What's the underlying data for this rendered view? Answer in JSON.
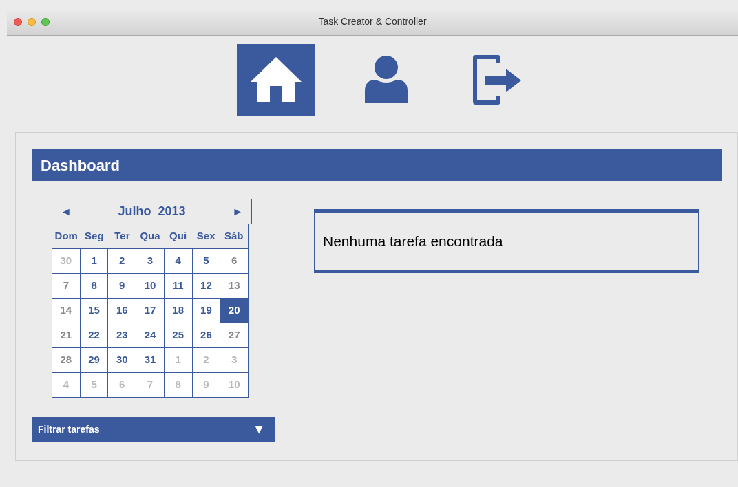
{
  "window": {
    "title": "Task Creator & Controller"
  },
  "nav": [
    {
      "kind": "home",
      "selected": true
    },
    {
      "kind": "user",
      "selected": false
    },
    {
      "kind": "logout",
      "selected": false
    }
  ],
  "dashboard": {
    "title": "Dashboard"
  },
  "calendar": {
    "prev": "◄",
    "month": "Julho",
    "year": "2013",
    "next": "►",
    "weekdays": [
      "Dom",
      "Seg",
      "Ter",
      "Qua",
      "Qui",
      "Sex",
      "Sáb"
    ],
    "weeks": [
      [
        {
          "day": "30",
          "kind": "other",
          "selected": false
        },
        {
          "day": "1",
          "kind": "current",
          "selected": false
        },
        {
          "day": "2",
          "kind": "current",
          "selected": false
        },
        {
          "day": "3",
          "kind": "current",
          "selected": false
        },
        {
          "day": "4",
          "kind": "current",
          "selected": false
        },
        {
          "day": "5",
          "kind": "current",
          "selected": false
        },
        {
          "day": "6",
          "kind": "weekend",
          "selected": false
        }
      ],
      [
        {
          "day": "7",
          "kind": "weekend",
          "selected": false
        },
        {
          "day": "8",
          "kind": "current",
          "selected": false
        },
        {
          "day": "9",
          "kind": "current",
          "selected": false
        },
        {
          "day": "10",
          "kind": "current",
          "selected": false
        },
        {
          "day": "11",
          "kind": "current",
          "selected": false
        },
        {
          "day": "12",
          "kind": "current",
          "selected": false
        },
        {
          "day": "13",
          "kind": "weekend",
          "selected": false
        }
      ],
      [
        {
          "day": "14",
          "kind": "weekend",
          "selected": false
        },
        {
          "day": "15",
          "kind": "current",
          "selected": false
        },
        {
          "day": "16",
          "kind": "current",
          "selected": false
        },
        {
          "day": "17",
          "kind": "current",
          "selected": false
        },
        {
          "day": "18",
          "kind": "current",
          "selected": false
        },
        {
          "day": "19",
          "kind": "current",
          "selected": false
        },
        {
          "day": "20",
          "kind": "weekend",
          "selected": true
        }
      ],
      [
        {
          "day": "21",
          "kind": "weekend",
          "selected": false
        },
        {
          "day": "22",
          "kind": "current",
          "selected": false
        },
        {
          "day": "23",
          "kind": "current",
          "selected": false
        },
        {
          "day": "24",
          "kind": "current",
          "selected": false
        },
        {
          "day": "25",
          "kind": "current",
          "selected": false
        },
        {
          "day": "26",
          "kind": "current",
          "selected": false
        },
        {
          "day": "27",
          "kind": "weekend",
          "selected": false
        }
      ],
      [
        {
          "day": "28",
          "kind": "weekend",
          "selected": false
        },
        {
          "day": "29",
          "kind": "current",
          "selected": false
        },
        {
          "day": "30",
          "kind": "current",
          "selected": false
        },
        {
          "day": "31",
          "kind": "current",
          "selected": false
        },
        {
          "day": "1",
          "kind": "other",
          "selected": false
        },
        {
          "day": "2",
          "kind": "other",
          "selected": false
        },
        {
          "day": "3",
          "kind": "other",
          "selected": false
        }
      ],
      [
        {
          "day": "4",
          "kind": "other",
          "selected": false
        },
        {
          "day": "5",
          "kind": "other",
          "selected": false
        },
        {
          "day": "6",
          "kind": "other",
          "selected": false
        },
        {
          "day": "7",
          "kind": "other",
          "selected": false
        },
        {
          "day": "8",
          "kind": "other",
          "selected": false
        },
        {
          "day": "9",
          "kind": "other",
          "selected": false
        },
        {
          "day": "10",
          "kind": "other",
          "selected": false
        }
      ]
    ]
  },
  "filter": {
    "label": "Filtrar tarefas",
    "caret": "▼"
  },
  "tasks": {
    "empty_message": "Nenhuma tarefa encontrada"
  }
}
